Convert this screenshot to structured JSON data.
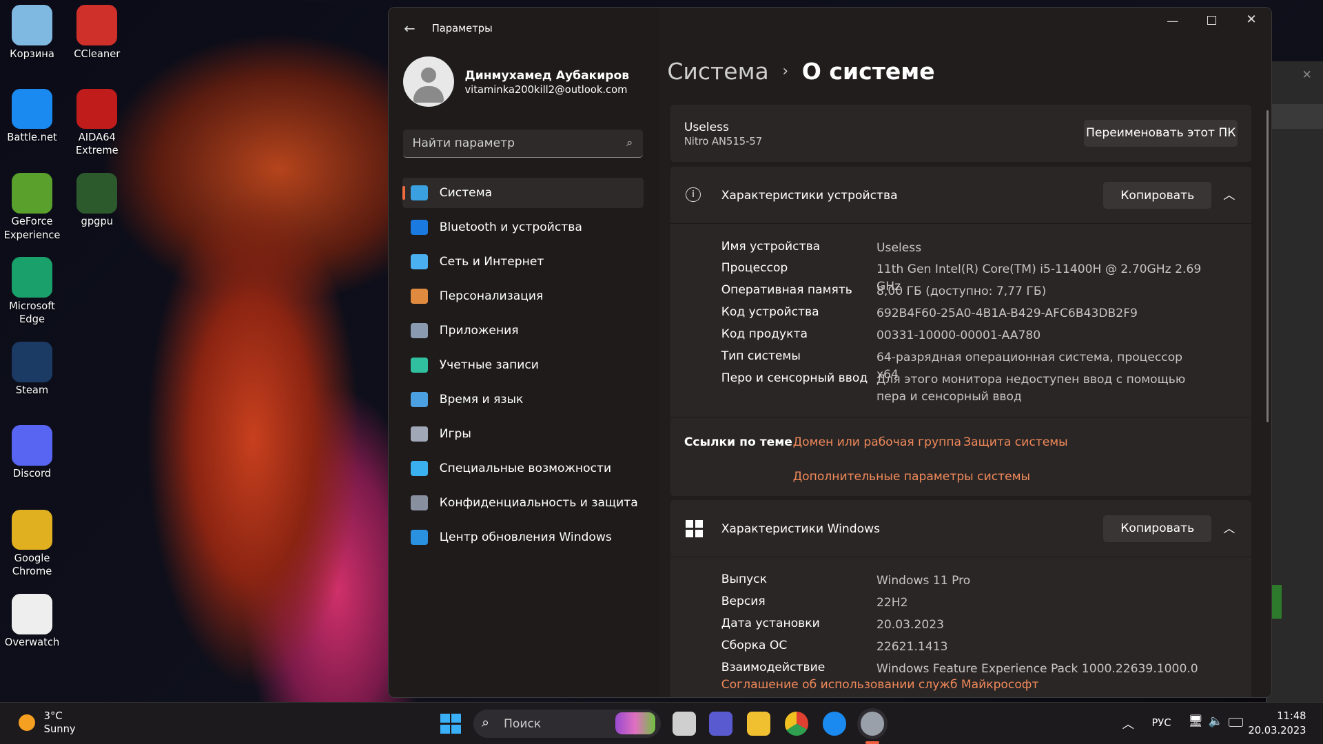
{
  "desktop": {
    "icons": [
      {
        "label": "Корзина",
        "color": "#7fb8e0"
      },
      {
        "label": "CCleaner",
        "color": "#d0302a"
      },
      {
        "label": "Battle.net",
        "color": "#1a8af0"
      },
      {
        "label": "AIDA64 Extreme",
        "color": "#c01c1c"
      },
      {
        "label": "GeForce Experience",
        "color": "#5aa02c"
      },
      {
        "label": "gpgpu",
        "color": "#2c5a2c"
      },
      {
        "label": "Microsoft Edge",
        "color": "#1aa06a"
      },
      {
        "label": "Steam",
        "color": "#1b3a64"
      },
      {
        "label": "Discord",
        "color": "#5865f2"
      },
      {
        "label": "Google Chrome",
        "color": "#e0b020"
      },
      {
        "label": "Overwatch",
        "color": "#eeeeee"
      }
    ]
  },
  "window": {
    "title": "Параметры",
    "back_icon": "arrow-left-icon",
    "controls": [
      "minimize",
      "maximize",
      "close"
    ]
  },
  "user": {
    "name": "Динмухамед Аубакиров",
    "email": "vitaminka200kill2@outlook.com"
  },
  "search": {
    "placeholder": "Найти параметр"
  },
  "nav": [
    {
      "label": "Система",
      "icon": "monitor-icon",
      "color": "#3aa0e0",
      "active": true
    },
    {
      "label": "Bluetooth и устройства",
      "icon": "bluetooth-icon",
      "color": "#1a7ae0"
    },
    {
      "label": "Сеть и Интернет",
      "icon": "wifi-icon",
      "color": "#4ab0f0"
    },
    {
      "label": "Персонализация",
      "icon": "brush-icon",
      "color": "#e08a40"
    },
    {
      "label": "Приложения",
      "icon": "apps-icon",
      "color": "#8a9ab0"
    },
    {
      "label": "Учетные записи",
      "icon": "person-icon",
      "color": "#30c0a0"
    },
    {
      "label": "Время и язык",
      "icon": "globe-clock-icon",
      "color": "#4aa0e0"
    },
    {
      "label": "Игры",
      "icon": "gamepad-icon",
      "color": "#a0a8b8"
    },
    {
      "label": "Специальные возможности",
      "icon": "accessibility-icon",
      "color": "#3ab0f0"
    },
    {
      "label": "Конфиденциальность и защита",
      "icon": "shield-icon",
      "color": "#8890a0"
    },
    {
      "label": "Центр обновления Windows",
      "icon": "update-icon",
      "color": "#2a90e0"
    }
  ],
  "breadcrumb": {
    "parent": "Система",
    "current": "О системе"
  },
  "pc": {
    "name": "Useless",
    "model": "Nitro AN515-57",
    "rename": "Переименовать этот ПК"
  },
  "device": {
    "title": "Характеристики устройства",
    "copy": "Копировать",
    "rows": [
      {
        "k": "Имя устройства",
        "v": "Useless"
      },
      {
        "k": "Процессор",
        "v": "11th Gen Intel(R) Core(TM) i5-11400H @ 2.70GHz   2.69 GHz"
      },
      {
        "k": "Оперативная память",
        "v": "8,00 ГБ (доступно: 7,77 ГБ)"
      },
      {
        "k": "Код устройства",
        "v": "692B4F60-25A0-4B1A-B429-AFC6B43DB2F9"
      },
      {
        "k": "Код продукта",
        "v": "00331-10000-00001-AA780"
      },
      {
        "k": "Тип системы",
        "v": "64-разрядная операционная система, процессор x64"
      },
      {
        "k": "Перо и сенсорный ввод",
        "v": "Для этого монитора недоступен ввод с помощью пера и сенсорный ввод"
      }
    ]
  },
  "links": {
    "label": "Ссылки по теме",
    "items": [
      "Домен или рабочая группа",
      "Защита системы",
      "Дополнительные параметры системы"
    ]
  },
  "windows": {
    "title": "Характеристики Windows",
    "copy": "Копировать",
    "rows": [
      {
        "k": "Выпуск",
        "v": "Windows 11 Pro"
      },
      {
        "k": "Версия",
        "v": "22H2"
      },
      {
        "k": "Дата установки",
        "v": "20.03.2023"
      },
      {
        "k": "Сборка ОС",
        "v": "22621.1413"
      },
      {
        "k": "Взаимодействие",
        "v": "Windows Feature Experience Pack 1000.22639.1000.0"
      }
    ],
    "agreement": "Соглашение об использовании служб Майкрософт"
  },
  "taskbar": {
    "weather_temp": "3°C",
    "weather_desc": "Sunny",
    "search": "Поиск",
    "lang": "РУС",
    "time": "11:48",
    "date": "20.03.2023",
    "apps": [
      "task-view",
      "meet",
      "explorer",
      "chrome",
      "battlenet",
      "settings"
    ]
  }
}
